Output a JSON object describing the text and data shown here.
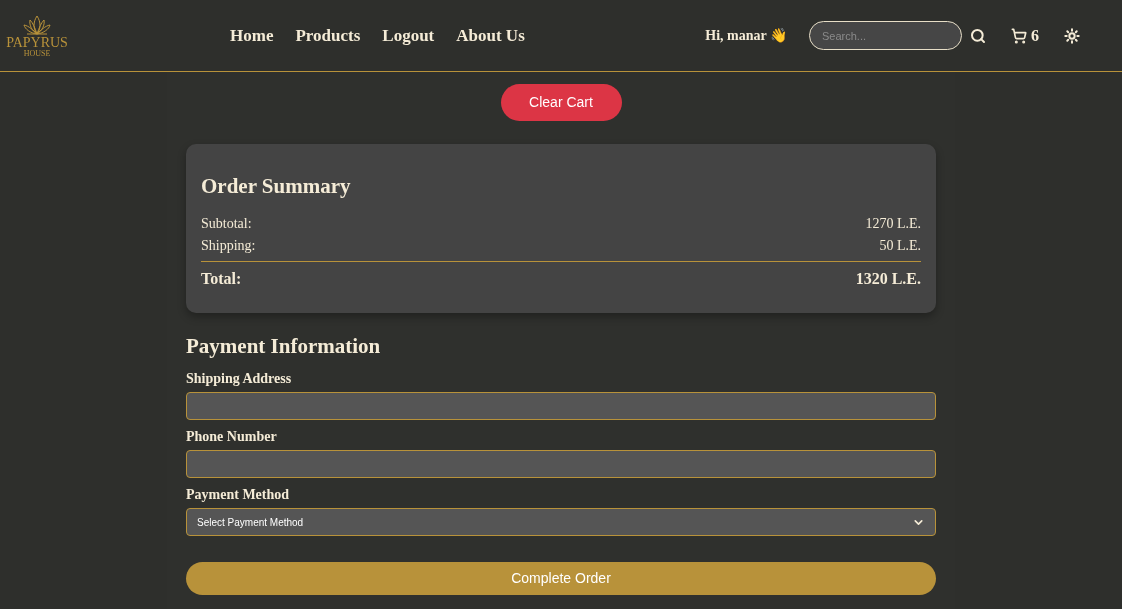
{
  "logo": {
    "line1": "PAPYRUS",
    "line2": "HOUSE"
  },
  "nav": [
    "Home",
    "Products",
    "Logout",
    "About Us"
  ],
  "greeting": "Hi, manar 👋",
  "search": {
    "placeholder": "Search..."
  },
  "cart_count": "6",
  "clear_button": "Clear Cart",
  "summary": {
    "title": "Order Summary",
    "rows": [
      {
        "label": "Subtotal:",
        "value": "1270 L.E."
      },
      {
        "label": "Shipping:",
        "value": "50 L.E."
      }
    ],
    "total": {
      "label": "Total:",
      "value": "1320 L.E."
    }
  },
  "payment": {
    "title": "Payment Information",
    "fields": [
      {
        "kind": "text",
        "label": "Shipping Address"
      },
      {
        "kind": "text",
        "label": "Phone Number"
      },
      {
        "kind": "select",
        "label": "Payment Method",
        "value": "Select Payment Method"
      }
    ]
  },
  "submit_button": "Complete Order"
}
